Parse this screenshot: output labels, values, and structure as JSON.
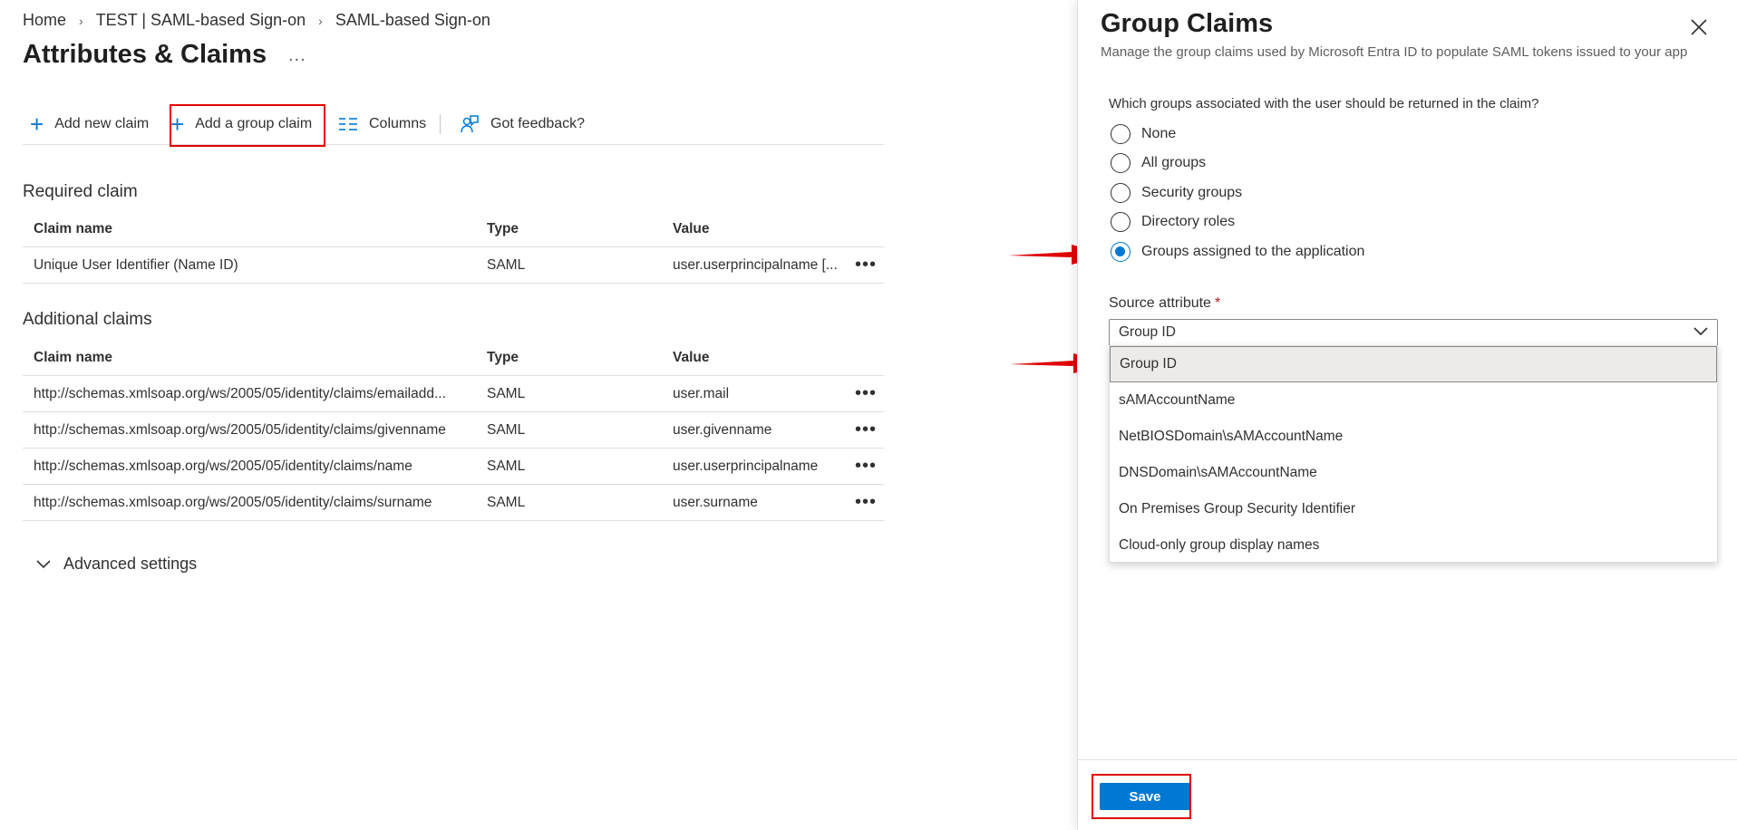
{
  "breadcrumb": {
    "items": [
      "Home",
      "TEST | SAML-based Sign-on",
      "SAML-based Sign-on"
    ]
  },
  "page": {
    "title": "Attributes & Claims",
    "more": "..."
  },
  "toolbar": {
    "add_new_claim": "Add new claim",
    "add_group_claim": "Add a group claim",
    "columns": "Columns",
    "feedback": "Got feedback?"
  },
  "required": {
    "title": "Required claim",
    "headers": [
      "Claim name",
      "Type",
      "Value"
    ],
    "rows": [
      {
        "name": "Unique User Identifier (Name ID)",
        "type": "SAML",
        "value": "user.userprincipalname [..."
      }
    ]
  },
  "additional": {
    "title": "Additional claims",
    "headers": [
      "Claim name",
      "Type",
      "Value"
    ],
    "rows": [
      {
        "name": "http://schemas.xmlsoap.org/ws/2005/05/identity/claims/emailadd...",
        "type": "SAML",
        "value": "user.mail"
      },
      {
        "name": "http://schemas.xmlsoap.org/ws/2005/05/identity/claims/givenname",
        "type": "SAML",
        "value": "user.givenname"
      },
      {
        "name": "http://schemas.xmlsoap.org/ws/2005/05/identity/claims/name",
        "type": "SAML",
        "value": "user.userprincipalname"
      },
      {
        "name": "http://schemas.xmlsoap.org/ws/2005/05/identity/claims/surname",
        "type": "SAML",
        "value": "user.surname"
      }
    ]
  },
  "row_more": "•••",
  "advanced_settings": "Advanced settings",
  "panel": {
    "title": "Group Claims",
    "subtitle": "Manage the group claims used by Microsoft Entra ID to populate SAML tokens issued to your app",
    "question": "Which groups associated with the user should be returned in the claim?",
    "options": [
      "None",
      "All groups",
      "Security groups",
      "Directory roles",
      "Groups assigned to the application"
    ],
    "selected_option": "Groups assigned to the application",
    "source_label": "Source attribute",
    "required_mark": "*",
    "source_value": "Group ID",
    "source_options": [
      "Group ID",
      "sAMAccountName",
      "NetBIOSDomain\\sAMAccountName",
      "DNSDomain\\sAMAccountName",
      "On Premises Group Security Identifier",
      "Cloud-only group display names"
    ],
    "save_label": "Save"
  },
  "colors": {
    "accent": "#0078d4",
    "highlight": "#e00000"
  }
}
